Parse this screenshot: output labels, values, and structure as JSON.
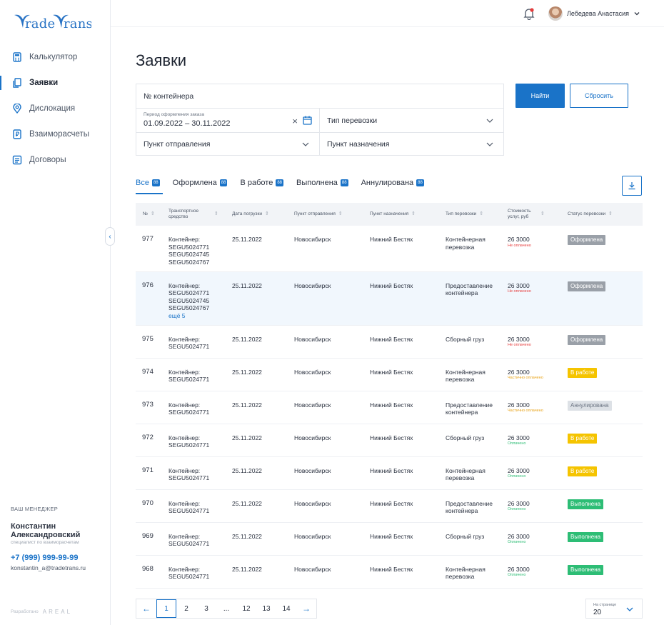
{
  "app": {
    "logo_text": "Tradetrans"
  },
  "sidebar": {
    "items": [
      {
        "label": "Калькулятор",
        "icon": "calculator-icon"
      },
      {
        "label": "Заявки",
        "icon": "documents-icon",
        "active": true
      },
      {
        "label": "Дислокация",
        "icon": "location-pin-icon"
      },
      {
        "label": "Взаиморасчеты",
        "icon": "ruble-doc-icon"
      },
      {
        "label": "Договоры",
        "icon": "contract-icon"
      }
    ],
    "manager": {
      "title": "ВАШ МЕНЕДЖЕР",
      "name": "Константин Александровский",
      "role": "специалист по взаиморасчетам",
      "phone": "+7 (999) 999-99-99",
      "email": "konstantin_a@tradetrans.ru"
    },
    "developer": {
      "label": "Разработано",
      "brand": "AREAL"
    }
  },
  "header": {
    "user_name": "Лебедева Анастасия",
    "notification": true
  },
  "page": {
    "title": "Заявки"
  },
  "filters": {
    "container_placeholder": "№ контейнера",
    "period_label": "Период оформления заказа",
    "period_value": "01.09.2022 – 30.11.2022",
    "transport_type": "Тип перевозки",
    "origin": "Пункт отправления",
    "destination": "Пункт назначения",
    "find": "Найти",
    "reset": "Сбросить"
  },
  "tabs": [
    {
      "label": "Все",
      "count": "88"
    },
    {
      "label": "Оформлена",
      "count": "88"
    },
    {
      "label": "В работе",
      "count": "88"
    },
    {
      "label": "Выполнена",
      "count": "88"
    },
    {
      "label": "Аннулирована",
      "count": "88"
    }
  ],
  "table": {
    "columns": [
      "№",
      "Транспортное средство",
      "Дата погрузки",
      "Пункт отправления",
      "Пункт назначения",
      "Тип перевозки",
      "Стоимость услуг, руб",
      "Статус перевозки"
    ],
    "rows": [
      {
        "n": "977",
        "vehicle": [
          "Контейнер:",
          "SEGU5024771",
          "SEGU5024745",
          "SEGU5024767"
        ],
        "date": "25.11.2022",
        "from": "Новосибирск",
        "to": "Нижний Бестях",
        "type": [
          "Контейнерная",
          "перевозка"
        ],
        "cost": "26 3000",
        "pay": "Не оплачено",
        "pay_color": "red",
        "status": "Оформлена",
        "status_color": "grey"
      },
      {
        "n": "976",
        "vehicle": [
          "Контейнер:",
          "SEGU5024771",
          "SEGU5024745",
          "SEGU5024767"
        ],
        "more": "ещё 5",
        "date": "25.11.2022",
        "from": "Новосибирск",
        "to": "Нижний Бестях",
        "type": [
          "Предоставление",
          "контейнера"
        ],
        "cost": "26 3000",
        "pay": "Не оплачено",
        "pay_color": "red",
        "status": "Оформлена",
        "status_color": "grey",
        "highlight": true
      },
      {
        "n": "975",
        "vehicle": [
          "Контейнер:",
          "SEGU5024771"
        ],
        "date": "25.11.2022",
        "from": "Новосибирск",
        "to": "Нижний Бестях",
        "type": [
          "Сборный груз"
        ],
        "cost": "26 3000",
        "pay": "Не оплачено",
        "pay_color": "red",
        "status": "Оформлена",
        "status_color": "grey"
      },
      {
        "n": "974",
        "vehicle": [
          "Контейнер:",
          "SEGU5024771"
        ],
        "date": "25.11.2022",
        "from": "Новосибирск",
        "to": "Нижний Бестях",
        "type": [
          "Контейнерная",
          "перевозка"
        ],
        "cost": "26 3000",
        "pay": "Частично оплачено",
        "pay_color": "orange",
        "status": "В работе",
        "status_color": "yellow"
      },
      {
        "n": "973",
        "vehicle": [
          "Контейнер:",
          "SEGU5024771"
        ],
        "date": "25.11.2022",
        "from": "Новосибирск",
        "to": "Нижний Бестях",
        "type": [
          "Предоставление",
          "контейнера"
        ],
        "cost": "26 3000",
        "pay": "Частично оплачено",
        "pay_color": "orange",
        "status": "Аннулирована",
        "status_color": "light"
      },
      {
        "n": "972",
        "vehicle": [
          "Контейнер:",
          "SEGU5024771"
        ],
        "date": "25.11.2022",
        "from": "Новосибирск",
        "to": "Нижний Бестях",
        "type": [
          "Сборный груз"
        ],
        "cost": "26 3000",
        "pay": "Оплачено",
        "pay_color": "green",
        "status": "В работе",
        "status_color": "yellow"
      },
      {
        "n": "971",
        "vehicle": [
          "Контейнер:",
          "SEGU5024771"
        ],
        "date": "25.11.2022",
        "from": "Новосибирск",
        "to": "Нижний Бестях",
        "type": [
          "Контейнерная",
          "перевозка"
        ],
        "cost": "26 3000",
        "pay": "Оплачено",
        "pay_color": "green",
        "status": "В работе",
        "status_color": "yellow"
      },
      {
        "n": "970",
        "vehicle": [
          "Контейнер:",
          "SEGU5024771"
        ],
        "date": "25.11.2022",
        "from": "Новосибирск",
        "to": "Нижний Бестях",
        "type": [
          "Предоставление",
          "контейнера"
        ],
        "cost": "26 3000",
        "pay": "Оплачено",
        "pay_color": "green",
        "status": "Выполнена",
        "status_color": "green"
      },
      {
        "n": "969",
        "vehicle": [
          "Контейнер:",
          "SEGU5024771"
        ],
        "date": "25.11.2022",
        "from": "Новосибирск",
        "to": "Нижний Бестях",
        "type": [
          "Сборный груз"
        ],
        "cost": "26 3000",
        "pay": "Оплачено",
        "pay_color": "green",
        "status": "Выполнена",
        "status_color": "green"
      },
      {
        "n": "968",
        "vehicle": [
          "Контейнер:",
          "SEGU5024771"
        ],
        "date": "25.11.2022",
        "from": "Новосибирск",
        "to": "Нижний Бестях",
        "type": [
          "Контейнерная",
          "перевозка"
        ],
        "cost": "26 3000",
        "pay": "Оплачено",
        "pay_color": "green",
        "status": "Выполнена",
        "status_color": "green"
      }
    ]
  },
  "pagination": {
    "prev": "←",
    "next": "→",
    "pages": [
      "1",
      "2",
      "3",
      "...",
      "12",
      "13",
      "14"
    ],
    "current": "1",
    "per_page_label": "На странице",
    "per_page_value": "20"
  }
}
